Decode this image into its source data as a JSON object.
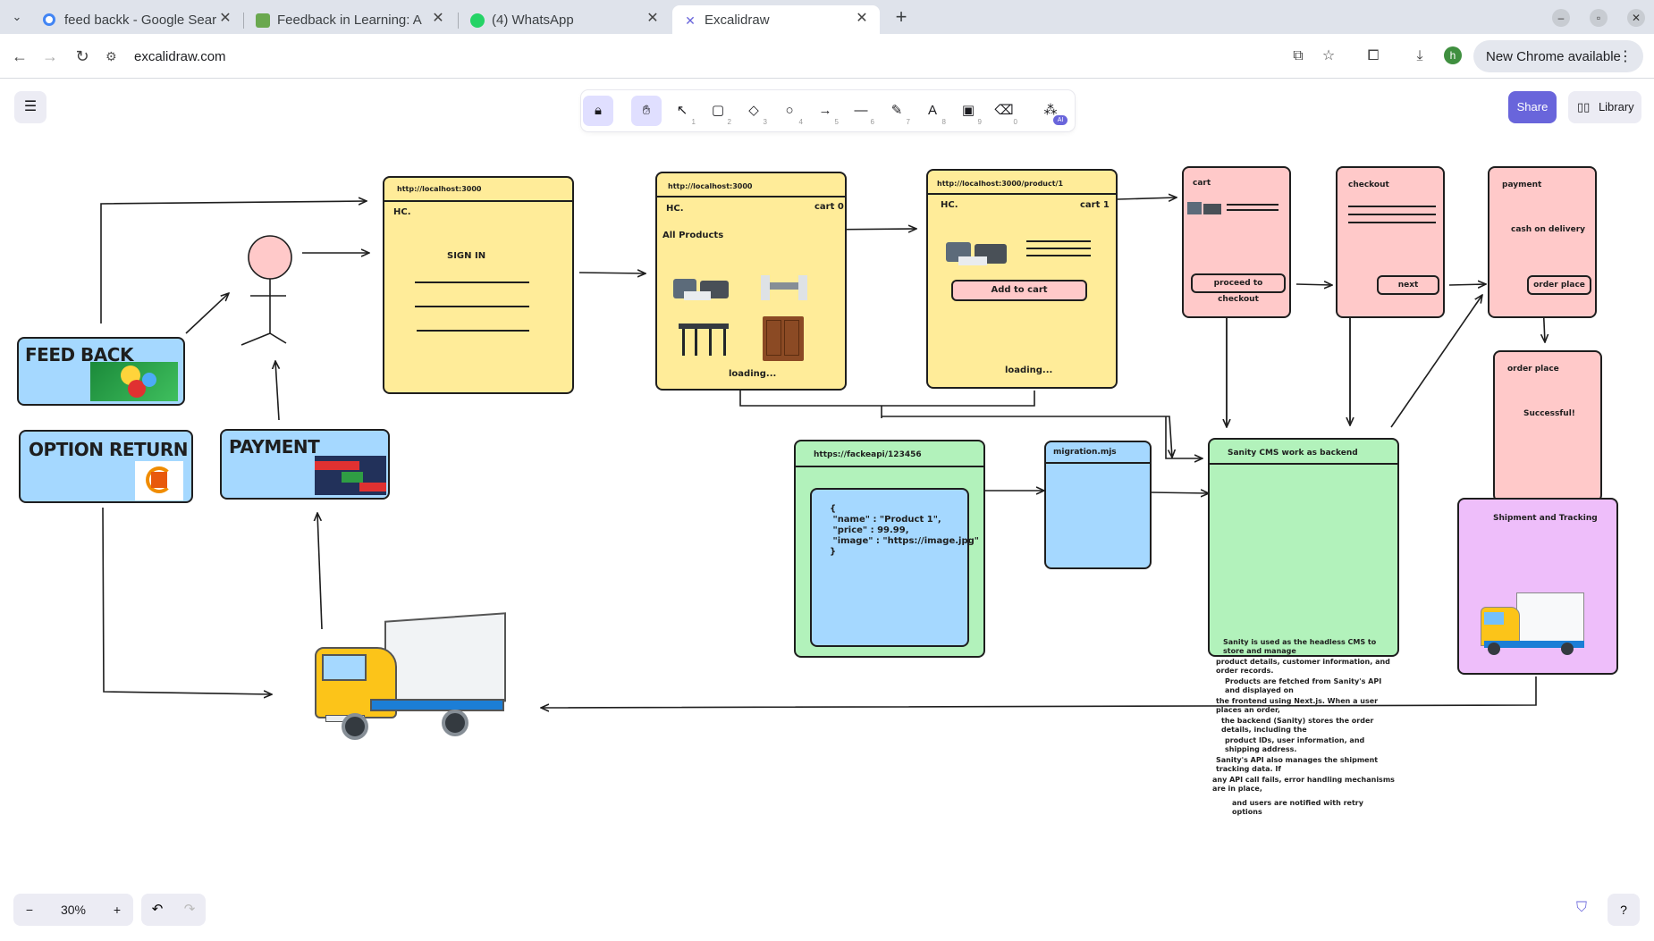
{
  "browser": {
    "tabs": [
      {
        "title": "feed backk - Google Sear",
        "favicon": "google-icon"
      },
      {
        "title": "Feedback in Learning: A",
        "favicon": "feedback-icon"
      },
      {
        "title": "(4) WhatsApp",
        "favicon": "whatsapp-icon"
      },
      {
        "title": "Excalidraw",
        "favicon": "excalidraw-icon",
        "active": true
      }
    ],
    "url": "excalidraw.com",
    "update_label": "New Chrome available",
    "profile_initial": "h"
  },
  "app": {
    "share_label": "Share",
    "library_label": "Library",
    "zoom": "30%",
    "tools": [
      {
        "name": "lock",
        "key": ""
      },
      {
        "name": "hand",
        "key": ""
      },
      {
        "name": "selection",
        "key": "1"
      },
      {
        "name": "rectangle",
        "key": "2"
      },
      {
        "name": "diamond",
        "key": "3"
      },
      {
        "name": "ellipse",
        "key": "4"
      },
      {
        "name": "arrow",
        "key": "5"
      },
      {
        "name": "line",
        "key": "6"
      },
      {
        "name": "draw",
        "key": "7"
      },
      {
        "name": "text",
        "key": "8"
      },
      {
        "name": "image",
        "key": "9"
      },
      {
        "name": "eraser",
        "key": "0"
      },
      {
        "name": "extra-tools",
        "key": "AI"
      }
    ]
  },
  "drawing": {
    "feedback_card": "FEED BACK",
    "option_return_card": "OPTION RETURN",
    "payment_card": "PAYMENT",
    "signin": {
      "url": "http://localhost:3000",
      "logo": "HC.",
      "label": "SIGN IN"
    },
    "products": {
      "url": "http://localhost:3000",
      "logo": "HC.",
      "cart": "cart 0",
      "heading": "All Products",
      "loading": "loading..."
    },
    "product": {
      "url": "http://localhost:3000/product/1",
      "logo": "HC.",
      "cart": "cart 1",
      "button": "Add to cart",
      "loading": "loading..."
    },
    "cart": {
      "title": "cart",
      "button": "proceed to checkout"
    },
    "checkout": {
      "title": "checkout",
      "button": "next"
    },
    "payment": {
      "title": "payment",
      "method": "cash on delivery",
      "button": "order place"
    },
    "order_place": {
      "title": "order place",
      "status": "Successful!"
    },
    "shipment": {
      "title": "Shipment and Tracking"
    },
    "fakeapi": {
      "url": "https://fackeapi/123456",
      "json": "{\n \"name\" : \"Product 1\",\n \"price\" : 99.99,\n \"image\" : \"https://image.jpg\"\n}"
    },
    "migration": {
      "title": "migration.mjs"
    },
    "sanity": {
      "title": "Sanity CMS work as backend",
      "lines": [
        "Sanity is used as the headless CMS to store and manage",
        "product details, customer information, and order records.",
        "Products are fetched from Sanity's API and displayed on",
        "the frontend using Next.js. When a user places an order,",
        "the backend (Sanity) stores the order details, including the",
        "product IDs, user information, and shipping address.",
        "Sanity's API also manages the shipment tracking data. If",
        "any API call fails, error handling mechanisms are in place,",
        "and users are notified with retry options"
      ]
    }
  }
}
